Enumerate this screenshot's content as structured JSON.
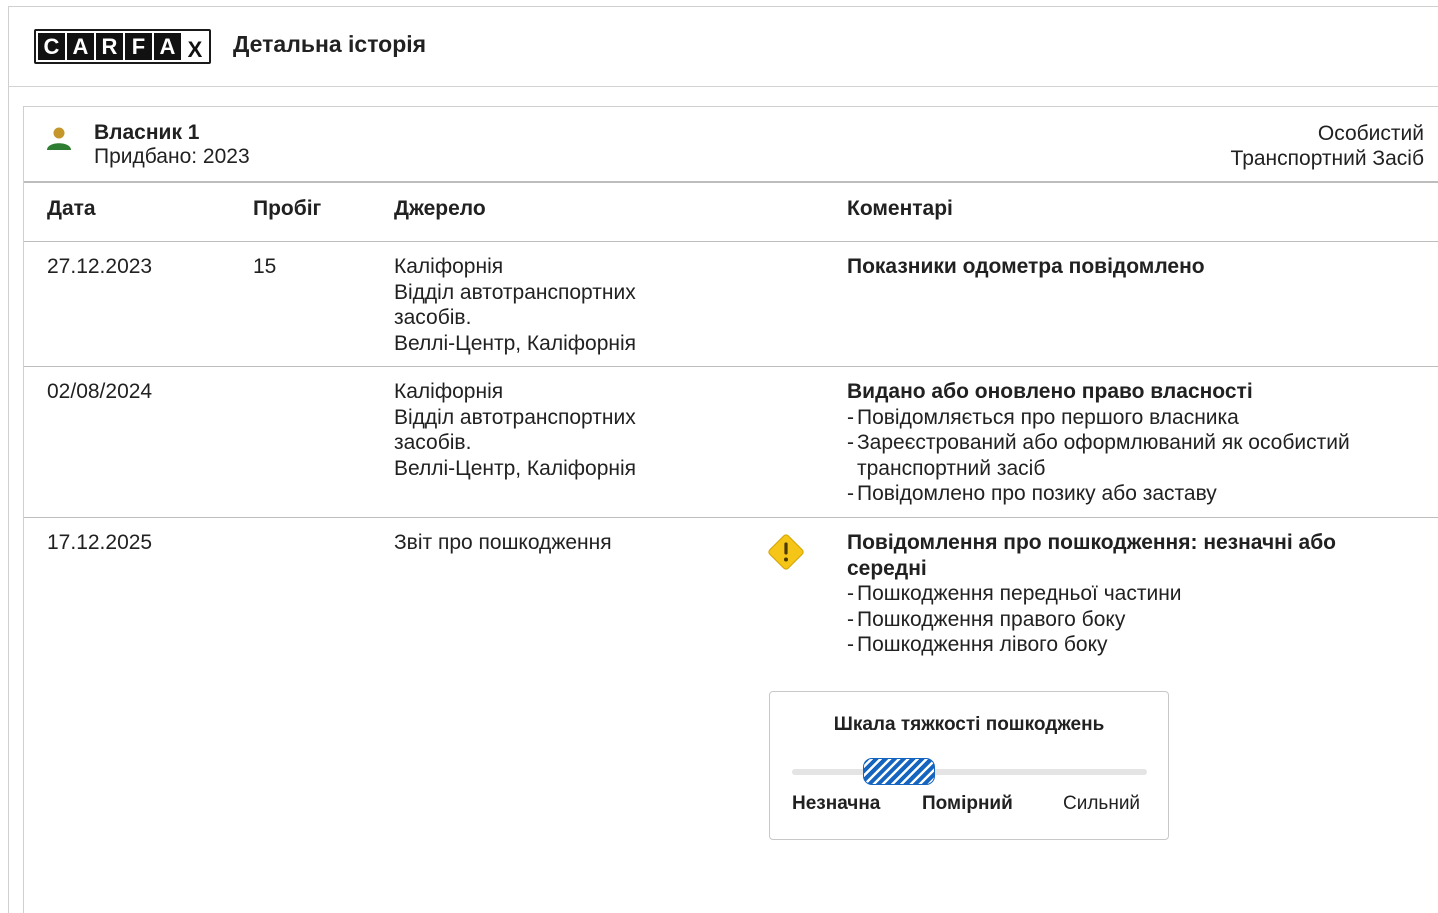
{
  "header": {
    "logo_letters": [
      "C",
      "A",
      "R",
      "F",
      "A",
      "X"
    ],
    "title": "Детальна історія"
  },
  "owner": {
    "name": "Власник 1",
    "purchased": "Придбано: 2023",
    "type_line1": "Особистий",
    "type_line2": "Транспортний Засіб",
    "icon_colors": {
      "head": "#c5962c",
      "body": "#2e7d32"
    }
  },
  "table": {
    "columns": [
      "Дата",
      "Пробіг",
      "Джерело",
      "Коментарі"
    ],
    "rows": [
      {
        "date": "27.12.2023",
        "mileage": "15",
        "source": [
          "Каліфорнія",
          "Відділ автотранспортних",
          "засобів.",
          "Веллі-Центр, Каліфорнія"
        ],
        "comment_title": "Показники одометра повідомлено",
        "comment_items": []
      },
      {
        "date": "02/08/2024",
        "mileage": "",
        "source": [
          "Каліфорнія",
          "Відділ автотранспортних",
          "засобів.",
          "Веллі-Центр, Каліфорнія"
        ],
        "comment_title": "Видано або оновлено право власності",
        "comment_items": [
          "Повідомляється про першого власника",
          "Зареєстрований або оформлюваний як особистий транспортний засіб",
          "Повідомлено про позику або заставу"
        ]
      },
      {
        "date": "17.12.2025",
        "mileage": "",
        "source": [
          "Звіт про пошкодження"
        ],
        "icon": "warning-icon",
        "comment_title": "Повідомлення про пошкодження: незначні або середні",
        "comment_items": [
          "Пошкодження передньої частини",
          "Пошкодження правого боку",
          "Пошкодження лівого боку"
        ]
      }
    ]
  },
  "severity_scale": {
    "title": "Шкала тяжкості пошкоджень",
    "labels": [
      "Незначна",
      "Помірний",
      "Сильний"
    ],
    "selected": "Помірний",
    "marker_color": "#1565c0"
  },
  "colors": {
    "warning": "#f5c518",
    "border": "#bdbdbd"
  }
}
